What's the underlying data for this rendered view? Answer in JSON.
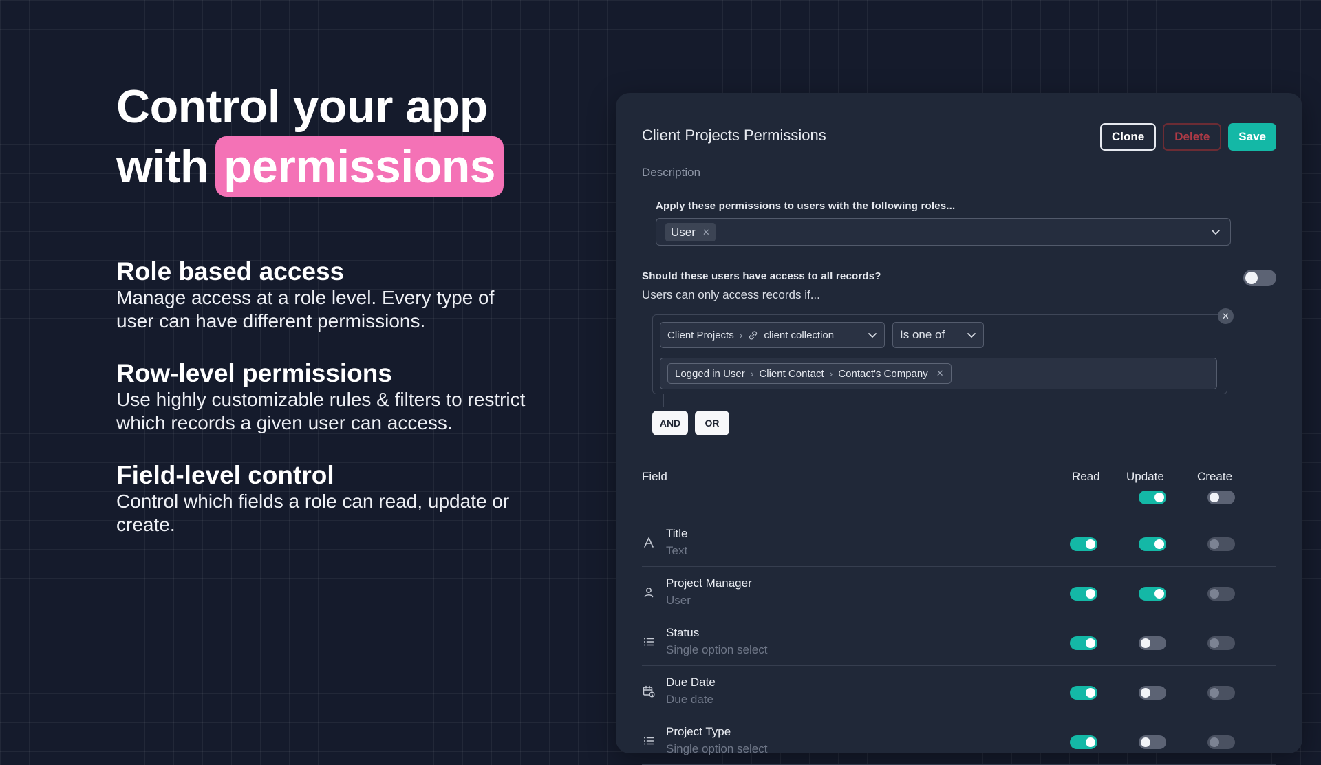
{
  "hero": {
    "title_line1": "Control your app",
    "title_line2_prefix": "with",
    "title_highlight": "permissions",
    "highlight_color": "#f472b6"
  },
  "features": [
    {
      "title": "Role based access",
      "body_line1": "Manage access at a role level. Every type of",
      "body_line2": "user can have different permissions."
    },
    {
      "title": "Row-level permissions",
      "body_line1": "Use highly customizable rules & filters to restrict",
      "body_line2": "which records a given user can access."
    },
    {
      "title": "Field-level control",
      "body_line1": "Control which fields a role can read, update or",
      "body_line2": "create."
    }
  ],
  "panel": {
    "title": "Client Projects Permissions",
    "clone_label": "Clone",
    "delete_label": "Delete",
    "save_label": "Save",
    "accent_color": "#14b8a6",
    "description_placeholder": "Description",
    "roles_label": "Apply these permissions to users with the following roles...",
    "roles_selected": [
      "User"
    ],
    "all_records_question": "Should these users have access to all records?",
    "all_records_enabled": false,
    "condition_intro": "Users can only access records if...",
    "condition": {
      "field_path": [
        "Client Projects",
        "client collection"
      ],
      "operator": "Is one of",
      "value_path": [
        "Logged in User",
        "Client Contact",
        "Contact's Company"
      ]
    },
    "and_label": "AND",
    "or_label": "OR",
    "table": {
      "col_field": "Field",
      "col_read": "Read",
      "col_update": "Update",
      "col_create": "Create",
      "all_update": true,
      "all_create": false,
      "rows": [
        {
          "name": "Title",
          "type": "Text",
          "icon": "text-type-icon",
          "read": true,
          "update": true,
          "create": false
        },
        {
          "name": "Project Manager",
          "type": "User",
          "icon": "user-icon",
          "read": true,
          "update": true,
          "create": false
        },
        {
          "name": "Status",
          "type": "Single option select",
          "icon": "list-icon",
          "read": true,
          "update": false,
          "create": false
        },
        {
          "name": "Due Date",
          "type": "Due date",
          "icon": "calendar-clock-icon",
          "read": true,
          "update": false,
          "create": false
        },
        {
          "name": "Project Type",
          "type": "Single option select",
          "icon": "list-icon",
          "read": true,
          "update": false,
          "create": false
        }
      ]
    }
  }
}
